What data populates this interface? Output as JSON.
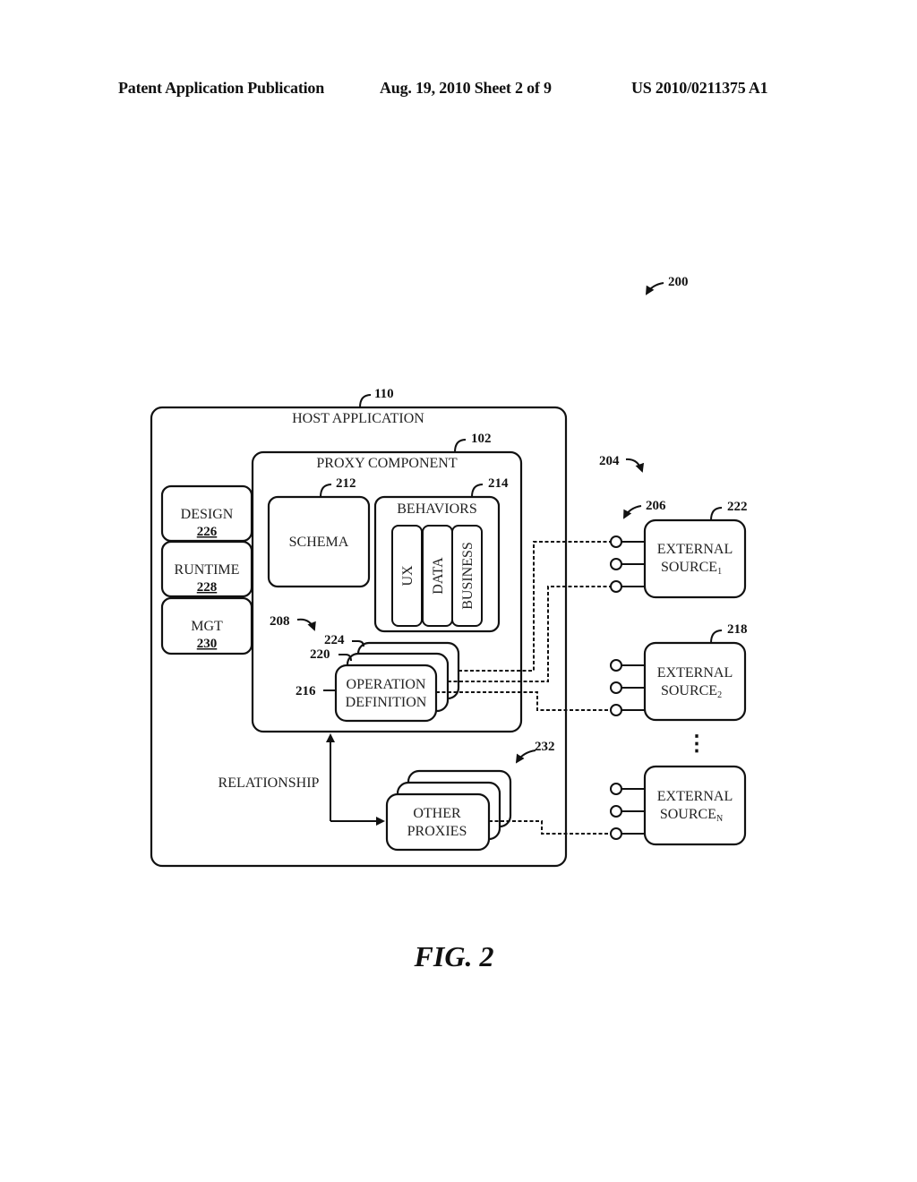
{
  "header": {
    "publication": "Patent Application Publication",
    "date_sheet": "Aug. 19, 2010  Sheet 2 of 9",
    "number": "US 2010/0211375 A1"
  },
  "figure": {
    "label": "FIG. 2",
    "ref": "200"
  },
  "host": {
    "label": "HOST APPLICATION",
    "ref": "110"
  },
  "proxy": {
    "label": "PROXY COMPONENT",
    "ref": "102"
  },
  "schema": {
    "label": "SCHEMA",
    "ref": "212"
  },
  "behaviors": {
    "label": "BEHAVIORS",
    "ref": "214",
    "items": [
      "UX",
      "DATA",
      "BUSINESS"
    ]
  },
  "side_modules": [
    {
      "label": "DESIGN",
      "ref": "226"
    },
    {
      "label": "RUNTIME",
      "ref": "228"
    },
    {
      "label": "MGT",
      "ref": "230"
    }
  ],
  "operation": {
    "line1": "OPERATION",
    "line2": "DEFINITION",
    "group_ref": "208",
    "refs": [
      "216",
      "220",
      "224"
    ]
  },
  "other_proxies": {
    "line1": "OTHER",
    "line2": "PROXIES",
    "ref": "232"
  },
  "relationship": {
    "label": "RELATIONSHIP"
  },
  "connectors": {
    "group_ref": "204",
    "ports_ref": "206"
  },
  "external_sources": [
    {
      "line1": "EXTERNAL",
      "line2": "SOURCE",
      "subscript": "1",
      "ref": "222"
    },
    {
      "line1": "EXTERNAL",
      "line2": "SOURCE",
      "subscript": "2",
      "ref": "218"
    },
    {
      "line1": "EXTERNAL",
      "line2": "SOURCE",
      "subscript": "N",
      "ref": ""
    }
  ],
  "ellipsis": "⋮"
}
